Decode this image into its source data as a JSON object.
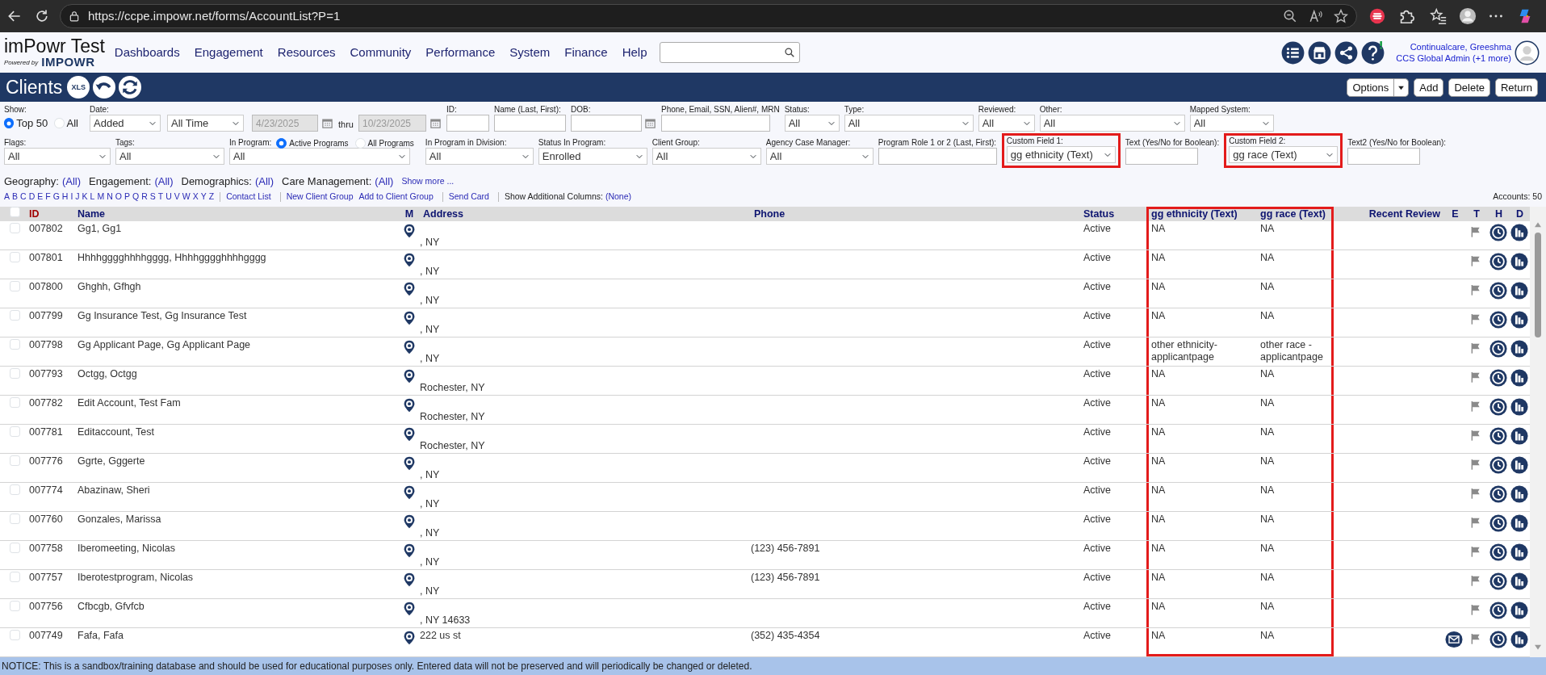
{
  "browser": {
    "url": "https://ccpe.impowr.net/forms/AccountList?P=1"
  },
  "header": {
    "app_title": "imPowr Test",
    "powered_by": "Powered by",
    "brand": "IMPOWR",
    "nav": [
      "Dashboards",
      "Engagement",
      "Resources",
      "Community",
      "Performance",
      "System",
      "Finance",
      "Help"
    ],
    "user": {
      "name": "Continualcare, Greeshma",
      "role": "CCS Global Admin (+1 more)"
    }
  },
  "page": {
    "title": "Clients",
    "export_label": "XLS",
    "buttons": [
      {
        "label": "Options",
        "kind": "split"
      },
      {
        "label": "Add",
        "kind": "plain"
      },
      {
        "label": "Delete",
        "kind": "plain"
      },
      {
        "label": "Return",
        "kind": "plain"
      }
    ]
  },
  "filters": {
    "row_1": [
      {
        "kind": "radio",
        "label": "Show:",
        "options": [
          {
            "label": "Top 50",
            "selected": true
          },
          {
            "label": "All",
            "selected": false
          }
        ]
      },
      {
        "kind": "date_range",
        "label": "Date:",
        "selects": [
          "Added",
          "All Time"
        ],
        "from": "4/23/2025",
        "joiner": "thru",
        "to": "10/23/2025",
        "disabled": true
      },
      {
        "kind": "input",
        "label": "ID:"
      },
      {
        "kind": "input",
        "label": "Name (Last, First):"
      },
      {
        "kind": "date",
        "label": "DOB:"
      },
      {
        "kind": "input",
        "label": "Phone, Email, SSN, Alien#, MRN"
      },
      {
        "kind": "select",
        "label": "Status:",
        "value": "All"
      },
      {
        "kind": "select",
        "label": "Type:",
        "value": "All"
      },
      {
        "kind": "select",
        "label": "Reviewed:",
        "value": "All"
      },
      {
        "kind": "select",
        "label": "Other:",
        "value": "All"
      },
      {
        "kind": "select",
        "label": "Mapped System:",
        "value": "All"
      }
    ],
    "row_2": [
      {
        "kind": "select",
        "label": "Flags:",
        "value": "All"
      },
      {
        "kind": "select",
        "label": "Tags:",
        "value": "All"
      },
      {
        "kind": "radio_select",
        "label": "In Program:",
        "options": [
          {
            "label": "Active Programs",
            "selected": true
          },
          {
            "label": "All Programs",
            "selected": false
          }
        ],
        "value": "All"
      },
      {
        "kind": "select",
        "label": "In Program in Division:",
        "value": "All"
      },
      {
        "kind": "select",
        "label": "Status In Program:",
        "value": "Enrolled"
      },
      {
        "kind": "select",
        "label": "Client Group:",
        "value": "All"
      },
      {
        "kind": "select",
        "label": "Agency Case Manager:",
        "value": "All"
      },
      {
        "kind": "input",
        "label": "Program Role 1 or 2 (Last, First):"
      },
      {
        "kind": "select",
        "label": "Custom Field 1:",
        "value": "gg ethnicity (Text)",
        "highlighted": true
      },
      {
        "kind": "input",
        "label": "Text (Yes/No for Boolean):"
      },
      {
        "kind": "select",
        "label": "Custom Field 2:",
        "value": "gg race (Text)",
        "highlighted": true
      },
      {
        "kind": "input",
        "label": "Text2 (Yes/No for Boolean):"
      }
    ],
    "summaries": [
      {
        "label": "Geography:",
        "value": "(All)"
      },
      {
        "label": "Engagement:",
        "value": "(All)"
      },
      {
        "label": "Demographics:",
        "value": "(All)"
      },
      {
        "label": "Care Management:",
        "value": "(All)"
      }
    ],
    "show_more": "Show more ...",
    "letters": [
      "A",
      "B",
      "C",
      "D",
      "E",
      "F",
      "G",
      "H",
      "I",
      "J",
      "K",
      "L",
      "M",
      "N",
      "O",
      "P",
      "Q",
      "R",
      "S",
      "T",
      "U",
      "V",
      "W",
      "X",
      "Y",
      "Z"
    ],
    "link_groups": [
      [
        "Contact List"
      ],
      [
        "New Client Group",
        "Add to Client Group"
      ],
      [
        "Send Card"
      ]
    ],
    "additional_columns": {
      "label": "Show Additional Columns:",
      "value": "(None)"
    },
    "accounts": "Accounts: 50"
  },
  "table": {
    "columns": [
      {
        "kind": "checkbox",
        "checked": false
      },
      {
        "kind": "text",
        "label": "ID",
        "sorted": true,
        "highlighted": false
      },
      {
        "kind": "text",
        "label": "Name",
        "sorted": false,
        "highlighted": false
      },
      {
        "kind": "text",
        "label": "M",
        "sorted": false,
        "highlighted": false
      },
      {
        "kind": "text",
        "label": "Address",
        "sorted": false,
        "highlighted": false
      },
      {
        "kind": "text",
        "label": "Phone",
        "sorted": false,
        "highlighted": false
      },
      {
        "kind": "text",
        "label": "Status",
        "sorted": false,
        "highlighted": false
      },
      {
        "kind": "text",
        "label": "gg ethnicity (Text)",
        "sorted": false,
        "highlighted": true
      },
      {
        "kind": "text",
        "label": "gg race (Text)",
        "sorted": false,
        "highlighted": true
      },
      {
        "kind": "text",
        "label": "Recent Review",
        "sorted": false,
        "highlighted": false
      },
      {
        "kind": "text",
        "label": "E",
        "sorted": false,
        "highlighted": false
      },
      {
        "kind": "text",
        "label": "T",
        "sorted": false,
        "highlighted": false
      },
      {
        "kind": "text",
        "label": "H",
        "sorted": false,
        "highlighted": false
      },
      {
        "kind": "text",
        "label": "D",
        "sorted": false,
        "highlighted": false
      }
    ],
    "rows": [
      {
        "checked": false,
        "id": "007802",
        "name": "Gg1, Gg1",
        "city": ", NY",
        "status": "Active",
        "custom_1": "NA",
        "custom_2": "NA",
        "flagged": false
      },
      {
        "checked": false,
        "id": "007801",
        "name": "Hhhhgggghhhhgggg, Hhhhgggghhhhgggg",
        "city": ", NY",
        "status": "Active",
        "custom_1": "NA",
        "custom_2": "NA",
        "flagged": false
      },
      {
        "checked": false,
        "id": "007800",
        "name": "Ghghh, Gfhgh",
        "city": ", NY",
        "status": "Active",
        "custom_1": "NA",
        "custom_2": "NA",
        "flagged": false
      },
      {
        "checked": false,
        "id": "007799",
        "name": "Gg Insurance Test, Gg Insurance Test",
        "city": ", NY",
        "status": "Active",
        "custom_1": "NA",
        "custom_2": "NA",
        "flagged": false
      },
      {
        "checked": false,
        "id": "007798",
        "name": "Gg Applicant Page, Gg Applicant Page",
        "city": ", NY",
        "status": "Active",
        "custom_1": "other ethnicity-applicantpage",
        "custom_2": "other race - applicantpage",
        "flagged": false
      },
      {
        "checked": false,
        "id": "007793",
        "name": "Octgg, Octgg",
        "city": "Rochester, NY",
        "status": "Active",
        "custom_1": "NA",
        "custom_2": "NA",
        "flagged": false
      },
      {
        "checked": false,
        "id": "007782",
        "name": "Edit Account, Test Fam",
        "city": "Rochester, NY",
        "status": "Active",
        "custom_1": "NA",
        "custom_2": "NA",
        "flagged": false
      },
      {
        "checked": false,
        "id": "007781",
        "name": "Editaccount, Test",
        "city": "Rochester, NY",
        "status": "Active",
        "custom_1": "NA",
        "custom_2": "NA",
        "flagged": false
      },
      {
        "checked": false,
        "id": "007776",
        "name": "Ggrte, Gggerte",
        "city": ", NY",
        "status": "Active",
        "custom_1": "NA",
        "custom_2": "NA",
        "flagged": false
      },
      {
        "checked": false,
        "id": "007774",
        "name": "Abazinaw, Sheri",
        "city": ", NY",
        "status": "Active",
        "custom_1": "NA",
        "custom_2": "NA",
        "flagged": false
      },
      {
        "checked": false,
        "id": "007760",
        "name": "Gonzales, Marissa",
        "city": ", NY",
        "status": "Active",
        "custom_1": "NA",
        "custom_2": "NA",
        "flagged": false
      },
      {
        "checked": false,
        "id": "007758",
        "name": "Iberomeeting, Nicolas",
        "city": ", NY",
        "phone": "(123) 456-7891",
        "status": "Active",
        "custom_1": "NA",
        "custom_2": "NA",
        "flagged": false
      },
      {
        "checked": false,
        "id": "007757",
        "name": "Iberotestprogram, Nicolas",
        "city": ", NY",
        "phone": "(123) 456-7891",
        "status": "Active",
        "custom_1": "NA",
        "custom_2": "NA",
        "flagged": false
      },
      {
        "checked": false,
        "id": "007756",
        "name": "Cfbcgb, Gfvfcb",
        "city": ", NY 14633",
        "status": "Active",
        "custom_1": "NA",
        "custom_2": "NA",
        "flagged": false
      },
      {
        "checked": false,
        "id": "007749",
        "name": "Fafa, Fafa",
        "street": "222 us st",
        "phone": "(352) 435-4354",
        "status": "Active",
        "custom_1": "NA",
        "custom_2": "NA",
        "email": true,
        "flagged": false
      }
    ]
  },
  "notice": "NOTICE: This is a sandbox/training database and should be used for educational purposes only. Entered data will not be preserved and will periodically be changed or deleted."
}
